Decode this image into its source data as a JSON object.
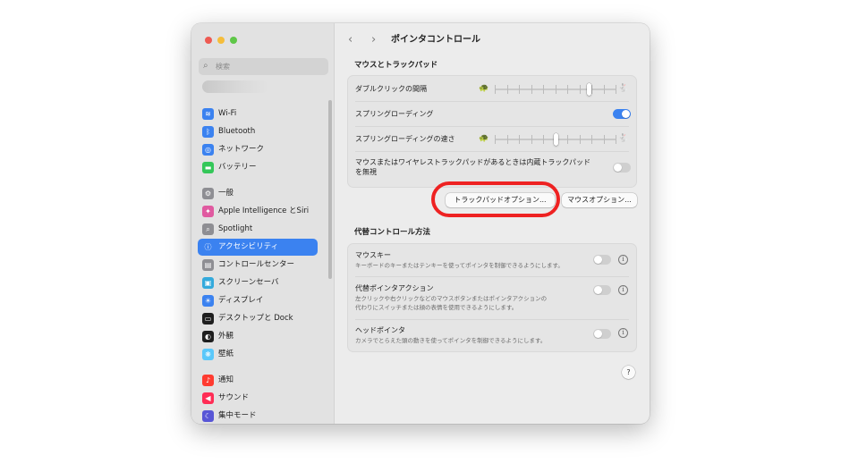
{
  "window": {
    "title": "ポインタコントロール",
    "nav_back": "‹",
    "nav_forward": "›",
    "traffic_lights": [
      "#ee5a52",
      "#f5bd3b",
      "#5fc748"
    ]
  },
  "sidebar": {
    "search_placeholder": "検索",
    "items": [
      {
        "label": "Wi-Fi",
        "icon": "wifi-icon",
        "glyph": "≋",
        "color": "#3b82f0"
      },
      {
        "label": "Bluetooth",
        "icon": "bluetooth-icon",
        "glyph": "ᛒ",
        "color": "#3b82f0"
      },
      {
        "label": "ネットワーク",
        "icon": "globe-icon",
        "glyph": "◎",
        "color": "#3b82f0"
      },
      {
        "label": "バッテリー",
        "icon": "battery-icon",
        "glyph": "▬",
        "color": "#34c759"
      },
      {
        "label": "一般",
        "icon": "gear-icon",
        "glyph": "⚙",
        "color": "#8e8e93"
      },
      {
        "label": "Apple Intelligence とSiri",
        "icon": "siri-icon",
        "glyph": "✦",
        "color": "#e05aa0"
      },
      {
        "label": "Spotlight",
        "icon": "magnifier-icon",
        "glyph": "⌕",
        "color": "#8e8e93"
      },
      {
        "label": "アクセシビリティ",
        "icon": "accessibility-icon",
        "glyph": "ⓘ",
        "color": "#3b82f0"
      },
      {
        "label": "コントロールセンター",
        "icon": "control-center-icon",
        "glyph": "▤",
        "color": "#8e8e93"
      },
      {
        "label": "スクリーンセーバ",
        "icon": "screensaver-icon",
        "glyph": "▣",
        "color": "#34aadc"
      },
      {
        "label": "ディスプレイ",
        "icon": "display-icon",
        "glyph": "☀",
        "color": "#3b82f0"
      },
      {
        "label": "デスクトップと Dock",
        "icon": "dock-icon",
        "glyph": "▭",
        "color": "#1e1e1e"
      },
      {
        "label": "外観",
        "icon": "appearance-icon",
        "glyph": "◐",
        "color": "#1e1e1e"
      },
      {
        "label": "壁紙",
        "icon": "wallpaper-icon",
        "glyph": "❋",
        "color": "#5ac8fa"
      },
      {
        "label": "通知",
        "icon": "bell-icon",
        "glyph": "♪",
        "color": "#ff3b30"
      },
      {
        "label": "サウンド",
        "icon": "speaker-icon",
        "glyph": "◀",
        "color": "#ff2d55"
      },
      {
        "label": "集中モード",
        "icon": "moon-icon",
        "glyph": "☾",
        "color": "#5856d6"
      }
    ]
  },
  "mouse_trackpad": {
    "title": "マウスとトラックパッド",
    "double_click_label": "ダブルクリックの間隔",
    "double_click_level": 0.78,
    "spring_loading_label": "スプリングローディング",
    "spring_loading_on": true,
    "spring_speed_label": "スプリングローディングの速さ",
    "spring_speed_level": 0.5,
    "ignore_trackpad_label": "マウスまたはワイヤレストラックパッドがあるときは内蔵トラックパッドを無視",
    "ignore_trackpad_on": false,
    "slow_icon": "turtle-icon",
    "fast_icon": "rabbit-icon",
    "trackpad_options_label": "トラックパッドオプション...",
    "mouse_options_label": "マウスオプション..."
  },
  "alt_control": {
    "title": "代替コントロール方法",
    "rows": [
      {
        "title": "マウスキー",
        "desc1": "キーボードのキーまたはテンキーを使ってポインタを制御できるようにします。",
        "desc2": "",
        "on": false
      },
      {
        "title": "代替ポインタアクション",
        "desc1": "左クリックや右クリックなどのマウスボタンまたはポインタアクションの",
        "desc2": "代わりにスイッチまたは顔の表情を使用できるようにします。",
        "on": false
      },
      {
        "title": "ヘッドポインタ",
        "desc1": "カメラでとらえた頭の動きを使ってポインタを制御できるようにします。",
        "desc2": "",
        "on": false
      }
    ]
  },
  "help_label": "?",
  "info_glyph": "i",
  "highlight_color": "#ee2222"
}
